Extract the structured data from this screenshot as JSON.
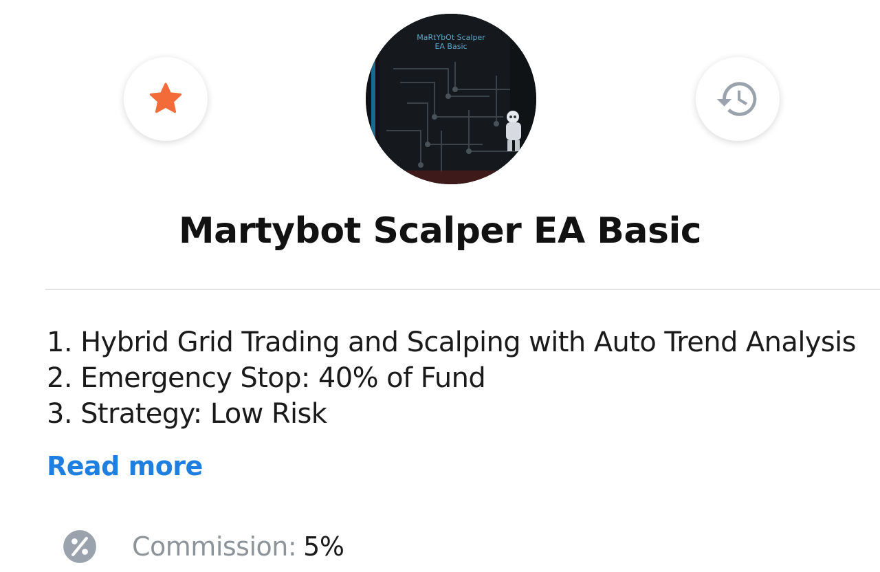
{
  "header": {
    "favorite_icon": "star-icon",
    "history_icon": "history-icon",
    "avatar": {
      "title_line1": "MaRtYbOt Scalper",
      "title_line2": "EA Basic",
      "image_description_icon": "robot-circuit-board-image"
    }
  },
  "product": {
    "title": "Martybot Scalper EA Basic",
    "description": [
      "1. Hybrid Grid Trading and Scalping with Auto Trend Analysis",
      "2. Emergency Stop: 40% of Fund",
      "3. Strategy: Low Risk"
    ],
    "read_more_label": "Read more"
  },
  "commission": {
    "icon": "percent-icon",
    "label": "Commission:",
    "value": "5%"
  },
  "colors": {
    "accent_orange": "#f26b38",
    "link_blue": "#1e7fe0",
    "icon_gray": "#9aa3ad"
  }
}
